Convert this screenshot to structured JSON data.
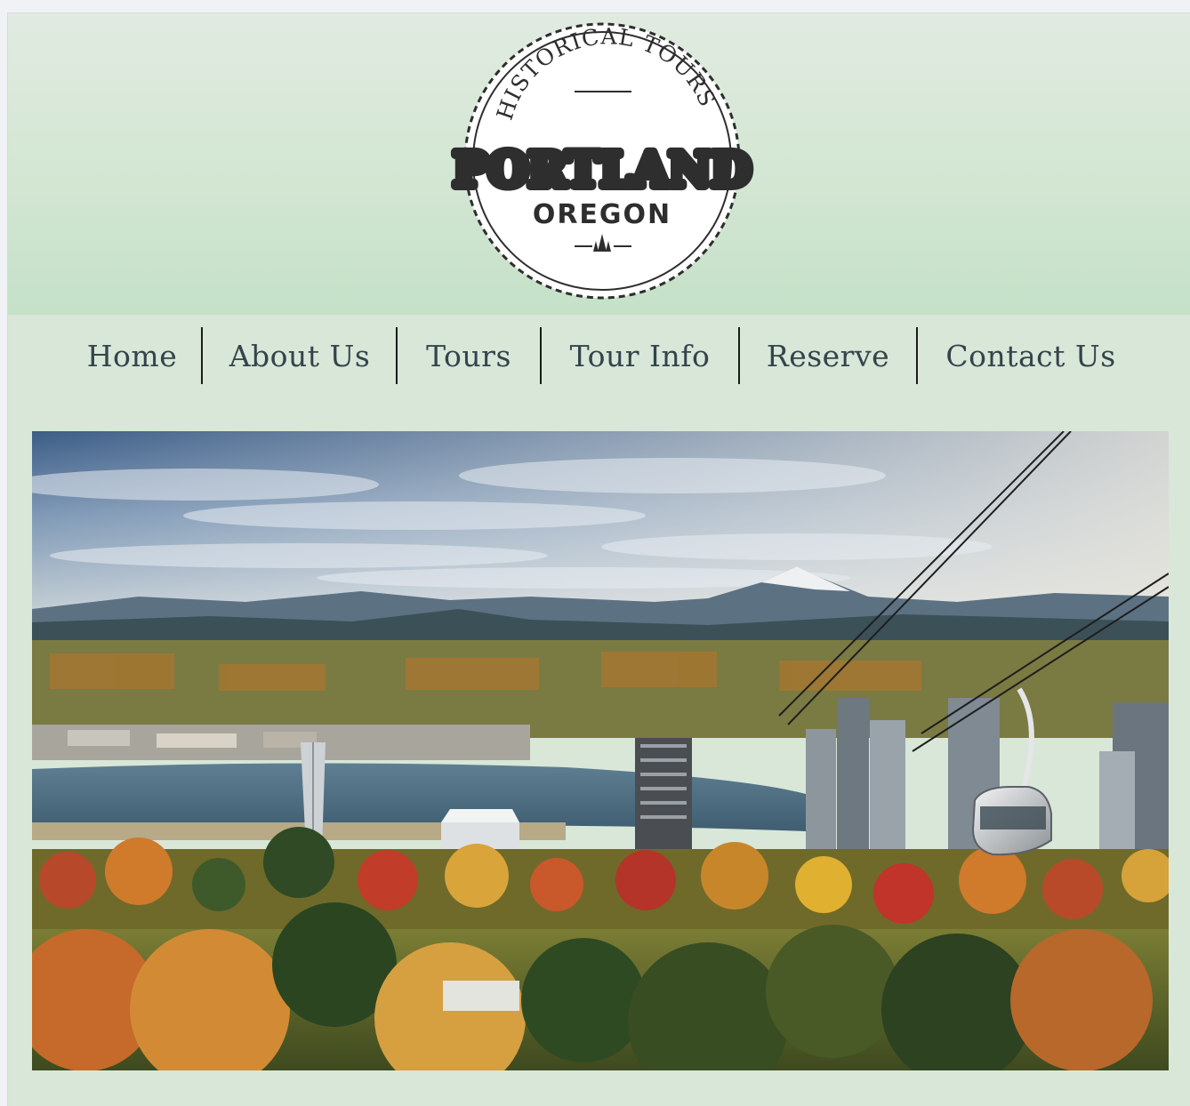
{
  "logo": {
    "top_arc": "HISTORICAL TOURS",
    "main": "PORTLAND",
    "sub": "OREGON",
    "ornament": "tree-icon"
  },
  "nav": {
    "items": [
      {
        "label": "Home"
      },
      {
        "label": "About Us"
      },
      {
        "label": "Tours"
      },
      {
        "label": "Tour Info"
      },
      {
        "label": "Reserve"
      },
      {
        "label": "Contact Us"
      }
    ]
  },
  "hero": {
    "icon": "landscape-photo"
  },
  "colors": {
    "page_bg": "#d8e7d8",
    "header_top": "#e1ebe1",
    "header_bottom": "#c5e1c8",
    "nav_text": "#34444c",
    "logo_ink": "#2e2e2e"
  }
}
